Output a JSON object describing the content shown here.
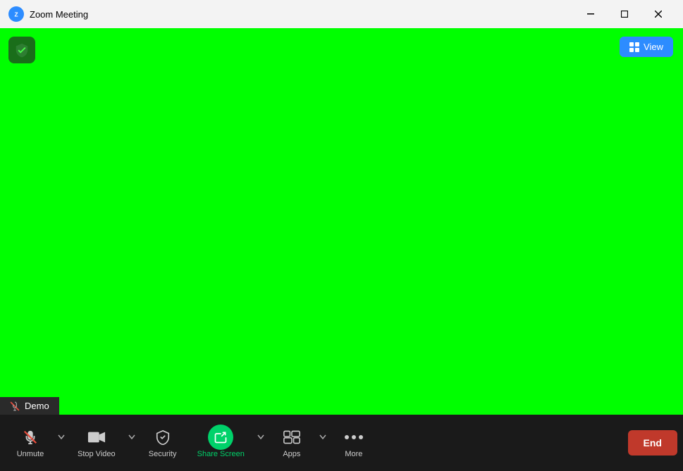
{
  "titleBar": {
    "title": "Zoom Meeting",
    "logo": "zoom-logo",
    "minimize": "−",
    "maximize": "□",
    "close": "✕"
  },
  "viewButton": {
    "label": "View",
    "icon": "grid-icon"
  },
  "shieldBadge": {
    "icon": "shield-check-icon"
  },
  "demoLabel": {
    "micIcon": "mic-muted-icon",
    "text": "Demo"
  },
  "toolbar": {
    "unmute": {
      "label": "Unmute",
      "icon": "mic-icon"
    },
    "stopVideo": {
      "label": "Stop Video",
      "icon": "video-icon"
    },
    "security": {
      "label": "Security",
      "icon": "shield-icon"
    },
    "shareScreen": {
      "label": "Share Screen",
      "icon": "share-icon"
    },
    "apps": {
      "label": "Apps",
      "icon": "apps-icon"
    },
    "more": {
      "label": "More",
      "icon": "more-icon"
    },
    "end": {
      "label": "End"
    }
  },
  "meetingBg": "#00ff00"
}
